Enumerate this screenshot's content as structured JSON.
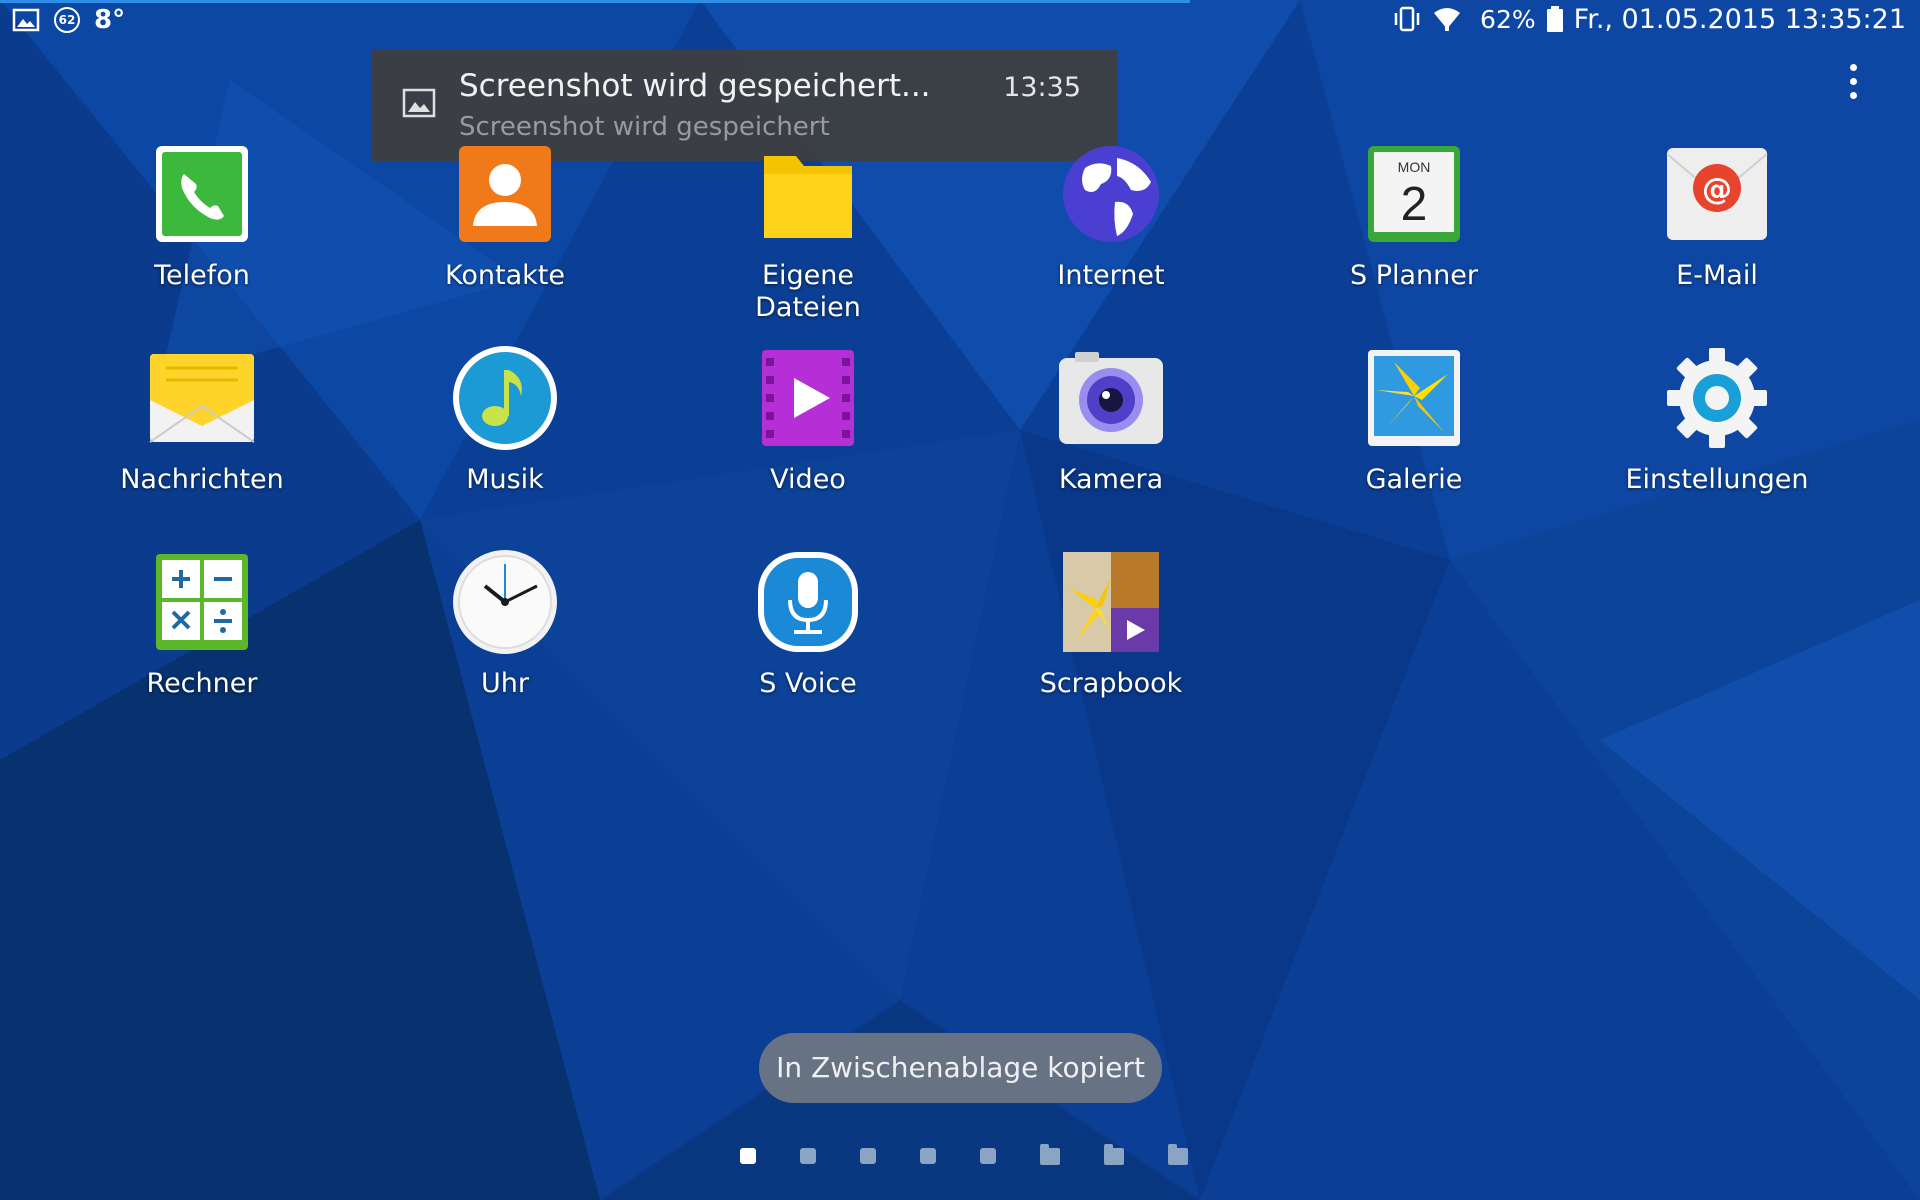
{
  "status_bar": {
    "temperature": "8°",
    "notif_badge": "62",
    "battery": "62%",
    "datetime": "Fr., 01.05.2015 13:35:21"
  },
  "notification": {
    "title": "Screenshot wird gespeichert...",
    "subtitle": "Screenshot wird gespeichert",
    "time": "13:35"
  },
  "apps": {
    "telefon": "Telefon",
    "kontakte": "Kontakte",
    "eigene_dateien": "Eigene Dateien",
    "internet": "Internet",
    "s_planner": "S Planner",
    "planner_day": "MON",
    "planner_date": "2",
    "email": "E-Mail",
    "nachrichten": "Nachrichten",
    "musik": "Musik",
    "video": "Video",
    "kamera": "Kamera",
    "galerie": "Galerie",
    "einstellungen": "Einstellungen",
    "rechner": "Rechner",
    "uhr": "Uhr",
    "s_voice": "S Voice",
    "scrapbook": "Scrapbook"
  },
  "toast": "In Zwischenablage kopiert",
  "pages": {
    "total": 8,
    "active": 1
  },
  "colors": {
    "wallpaper": "#0a3f96",
    "accent": "#2f8fe6"
  }
}
